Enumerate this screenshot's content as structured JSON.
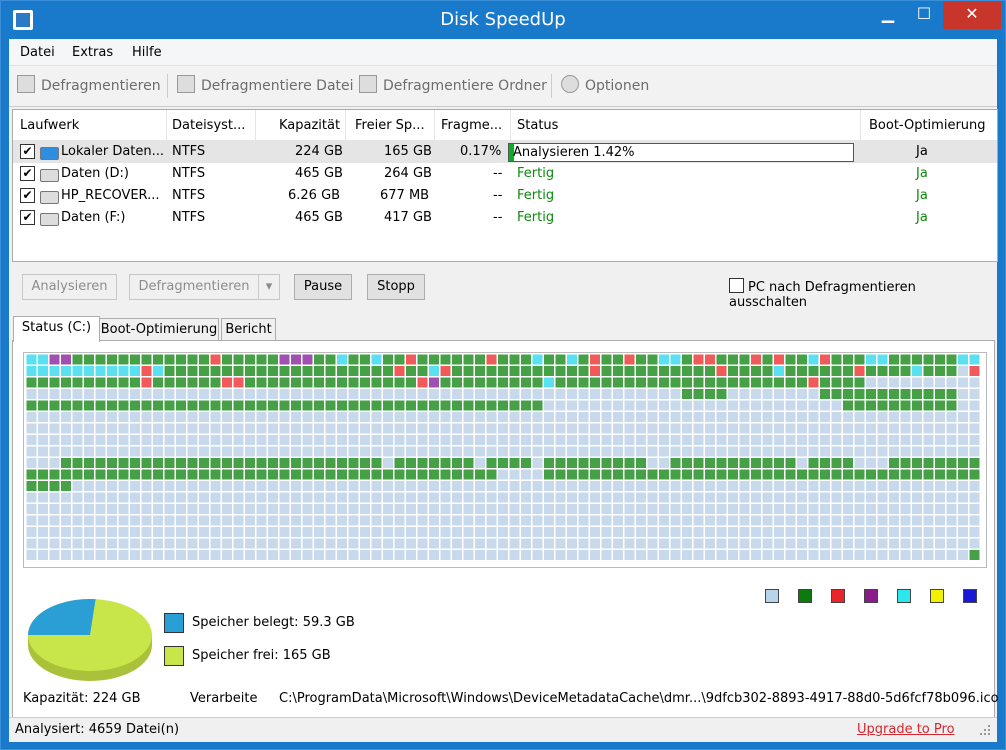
{
  "window": {
    "title": "Disk SpeedUp",
    "minimize_label": "▁",
    "maximize_label": "☐",
    "close_label": "✕"
  },
  "menu": [
    "Datei",
    "Extras",
    "Hilfe"
  ],
  "toolbar": {
    "defrag": "Defragmentieren",
    "defrag_file": "Defragmentiere Datei",
    "defrag_folder": "Defragmentiere Ordner",
    "options": "Optionen"
  },
  "columns": [
    "Laufwerk",
    "Dateisyst...",
    "Kapazität",
    "Freier Sp...",
    "Fragme...",
    "Status",
    "Boot-Optimierung"
  ],
  "drives": [
    {
      "name": "Lokaler Daten...",
      "fs": "NTFS",
      "capacity": "224 GB",
      "free": "165 GB",
      "frag": "0.17%",
      "status": "Analysieren 1.42%",
      "progress": 1.42,
      "boot": "Ja",
      "checked": "✔",
      "selected": true
    },
    {
      "name": "Daten (D:)",
      "fs": "NTFS",
      "capacity": "465 GB",
      "free": "264 GB",
      "frag": "--",
      "status": "Fertig",
      "boot": "Ja",
      "checked": "✔"
    },
    {
      "name": "HP_RECOVER...",
      "fs": "NTFS",
      "capacity": "6.26 GB",
      "free": "677 MB",
      "frag": "--",
      "status": "Fertig",
      "boot": "Ja",
      "checked": "✔"
    },
    {
      "name": "Daten (F:)",
      "fs": "NTFS",
      "capacity": "465 GB",
      "free": "417 GB",
      "frag": "--",
      "status": "Fertig",
      "boot": "Ja",
      "checked": "✔"
    }
  ],
  "buttons": {
    "analyze": "Analysieren",
    "defrag": "Defragmentieren",
    "dropdown": "▾",
    "pause": "Pause",
    "stop": "Stopp"
  },
  "shutdown_checkbox": "PC nach Defragmentieren ausschalten",
  "tabs": [
    "Status (C:)",
    "Boot-Optimierung",
    "Bericht"
  ],
  "legend_colors": [
    "#b8d4ea",
    "#0d7a0d",
    "#e8262a",
    "#8b1a8b",
    "#2ee6ee",
    "#f2f200",
    "#1a1ad4"
  ],
  "map_colors": {
    "free": "#c8d9eb",
    "used": "#46a046",
    "fragmented": "#f05a5a",
    "system": "#a050b0",
    "mft": "#5ae0f0"
  },
  "usage": {
    "used_label": "Speicher belegt: 59.3 GB",
    "free_label": "Speicher frei: 165 GB",
    "used_gb": 59.3,
    "free_gb": 165,
    "used_color": "#2a9fd6",
    "free_color": "#c8e64a"
  },
  "info": {
    "capacity": "Kapazität: 224 GB",
    "processing_label": "Verarbeite",
    "processing_path": "C:\\ProgramData\\Microsoft\\Windows\\DeviceMetadataCache\\dmr...\\9dfcb302-8893-4917-88d0-5d6fcf78b096.ico"
  },
  "statusbar": {
    "analyzed": "Analysiert: 4659 Datei(n)",
    "upgrade": "Upgrade to Pro"
  }
}
